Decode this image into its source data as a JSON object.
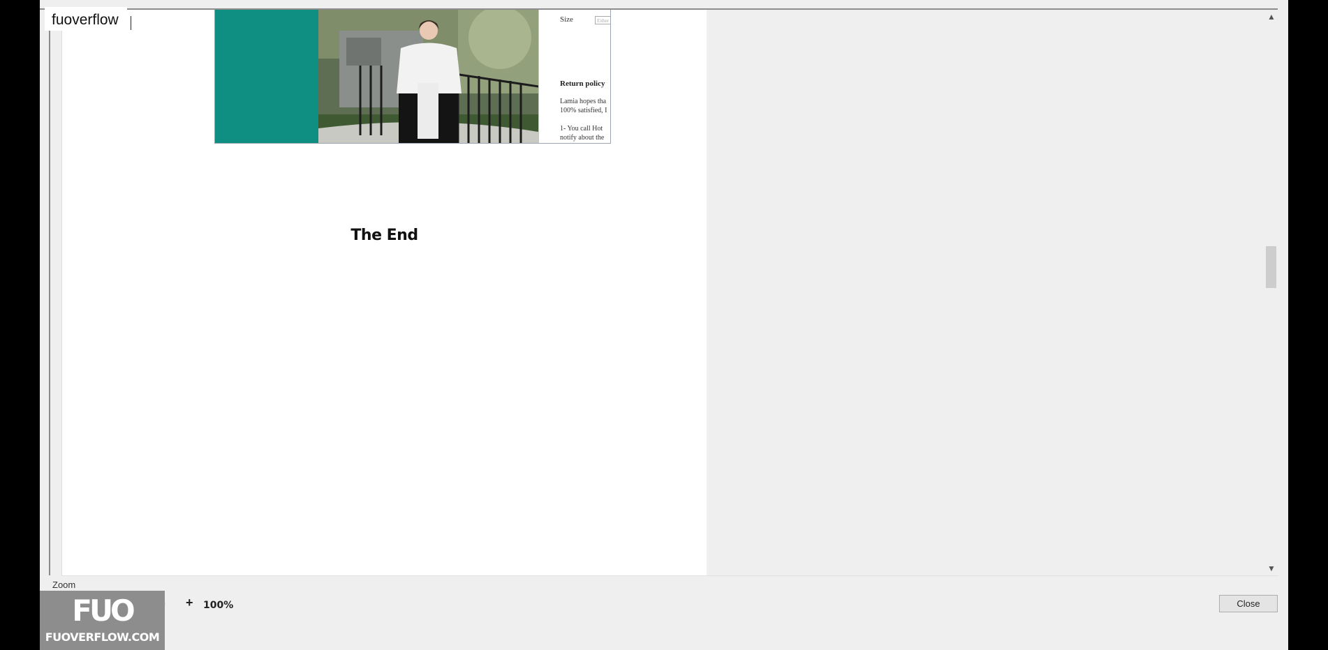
{
  "watermark": {
    "top_text": "fuoverflow",
    "logo_mark": "FUO",
    "logo_url": "FUOVERFLOW.COM"
  },
  "preview": {
    "size_label": "Size",
    "size_placeholder": "Either",
    "return_policy_heading": "Return policy",
    "return_policy_text": "Lamia hopes tha\n100% satisfied, I",
    "return_policy_step": "1- You call Hot\nnotify about the",
    "end_text": "The End"
  },
  "scrollbar": {
    "up_icon": "▲",
    "down_icon": "▼"
  },
  "zoom": {
    "label": "Zoom",
    "minus": "-",
    "plus": "+",
    "value": "100%"
  },
  "buttons": {
    "close": "Close"
  },
  "colors": {
    "teal_panel": "#0f8f82",
    "accent": "#1a7bd0"
  }
}
